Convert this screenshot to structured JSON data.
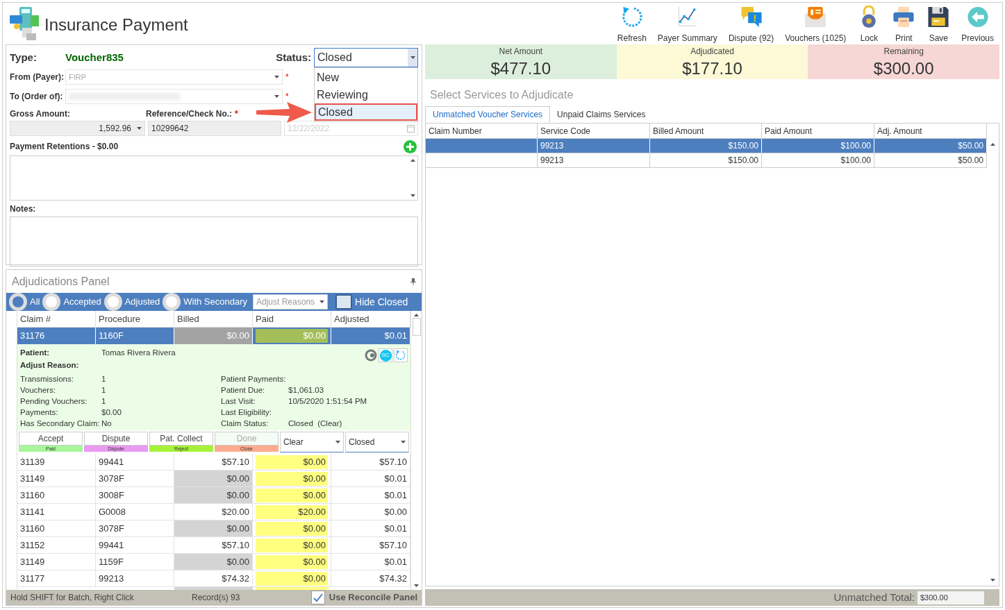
{
  "header": {
    "title": "Insurance Payment",
    "toolbar": [
      {
        "kind": "refresh",
        "label": "Refresh"
      },
      {
        "kind": "chart",
        "label": "Payer Summary"
      },
      {
        "kind": "dispute",
        "label": "Dispute (92)"
      },
      {
        "kind": "vouchers",
        "label": "Vouchers (1025)"
      },
      {
        "kind": "lock",
        "label": "Lock"
      },
      {
        "kind": "print",
        "label": "Print"
      },
      {
        "kind": "save",
        "label": "Save"
      },
      {
        "kind": "previous",
        "label": "Previous"
      }
    ]
  },
  "form": {
    "type_label": "Type:",
    "type_value": "Voucher835",
    "status_label": "Status:",
    "status_value": "Closed",
    "status_options": [
      {
        "label": "New",
        "selected": false
      },
      {
        "label": "Reviewing",
        "selected": false
      },
      {
        "label": "Closed",
        "selected": true
      }
    ],
    "from_label": "From (Payer):",
    "from_value": "FIRP",
    "to_label": "To (Order of):",
    "required_mark": "*",
    "gross_label": "Gross Amount:",
    "gross_value": "1,592.96",
    "reference_label": "Reference/Check No.:",
    "reference_value": "10299642",
    "date_value": "12/22/2022",
    "retentions_label": "Payment Retentions - $0.00",
    "notes_label": "Notes:"
  },
  "adjudications": {
    "title": "Adjudications Panel",
    "filters": [
      {
        "label": "All",
        "selected": true
      },
      {
        "label": "Accepted",
        "selected": false
      },
      {
        "label": "Adjusted",
        "selected": false
      },
      {
        "label": "With Secondary",
        "selected": false
      }
    ],
    "adjust_reasons": "Adjust Reasons",
    "hide_closed": {
      "label": "Hide Closed",
      "checked": false
    },
    "columns": [
      "Claim #",
      "Procedure",
      "Billed",
      "Paid",
      "Adjusted"
    ],
    "selected_row": [
      "31176",
      "1160F",
      "$0.00",
      "$0.00",
      "$0.01"
    ],
    "detail": {
      "patient_label": "Patient:",
      "patient_value": "Tomas Rivera Rivera",
      "adjust_reason_label": "Adjust Reason:",
      "badge": "SC",
      "left_fields": [
        {
          "label": "Transmissions:",
          "value": "1"
        },
        {
          "label": "Vouchers:",
          "value": "1"
        },
        {
          "label": "Pending Vouchers:",
          "value": "1"
        },
        {
          "label": "Payments:",
          "value": "$0.00"
        },
        {
          "label": "Has Secondary Claim:",
          "value": "No"
        }
      ],
      "right_fields": [
        {
          "label": "Patient Payments:"
        },
        {
          "label": "Patient Due:",
          "value": "$1,061.03"
        },
        {
          "label": "Last Visit:",
          "value": "10/5/2020 1:51:54 PM"
        },
        {
          "label": "Last Eligibility:"
        },
        {
          "label": "Claim Status:",
          "value": "Closed  (Clear)"
        }
      ],
      "actions": [
        {
          "label": "Accept",
          "tag": "Paid",
          "color": "#a8f59a",
          "disabled": false
        },
        {
          "label": "Dispute",
          "tag": "Dispute",
          "color": "#e89bf0",
          "disabled": false
        },
        {
          "label": "Pat. Collect",
          "tag": "Reject",
          "color": "#a6f23a",
          "disabled": false
        },
        {
          "label": "Done",
          "tag": "Close",
          "color": "#fcab8e",
          "disabled": true
        }
      ],
      "dropdowns": [
        "Clear",
        "Closed"
      ]
    },
    "rows": [
      {
        "cells": [
          "31139",
          "99441",
          "$57.10",
          "$0.00",
          "$57.10"
        ],
        "billed_shaded": false
      },
      {
        "cells": [
          "31149",
          "3078F",
          "$0.00",
          "$0.00",
          "$0.01"
        ],
        "billed_shaded": true
      },
      {
        "cells": [
          "31160",
          "3008F",
          "$0.00",
          "$0.00",
          "$0.01"
        ],
        "billed_shaded": true
      },
      {
        "cells": [
          "31141",
          "G0008",
          "$20.00",
          "$20.00",
          "$0.00"
        ],
        "billed_shaded": false
      },
      {
        "cells": [
          "31160",
          "3078F",
          "$0.00",
          "$0.00",
          "$0.01"
        ],
        "billed_shaded": true
      },
      {
        "cells": [
          "31152",
          "99441",
          "$57.10",
          "$0.00",
          "$57.10"
        ],
        "billed_shaded": false
      },
      {
        "cells": [
          "31149",
          "1159F",
          "$0.00",
          "$0.00",
          "$0.01"
        ],
        "billed_shaded": true
      },
      {
        "cells": [
          "31177",
          "99213",
          "$74.32",
          "$0.00",
          "$74.32"
        ],
        "billed_shaded": false
      }
    ],
    "status_text": "Hold SHIFT for Batch, Right Click",
    "records": "Record(s) 93",
    "use_reconcile": {
      "label": "Use Reconcile Panel",
      "checked": true
    }
  },
  "services": {
    "summary": [
      {
        "label": "Net Amount",
        "value": "$477.10",
        "color": "#dcefdc"
      },
      {
        "label": "Adjudicated",
        "value": "$177.10",
        "color": "#fdf9d7"
      },
      {
        "label": "Remaining",
        "value": "$300.00",
        "color": "#f7d6d6"
      }
    ],
    "title": "Select Services to Adjudicate",
    "tabs": [
      {
        "label": "Unmatched Voucher Services",
        "selected": true
      },
      {
        "label": "Unpaid Claims Services",
        "selected": false
      }
    ],
    "columns": [
      "Claim Number",
      "Service Code",
      "Billed Amount",
      "Paid Amount",
      "Adj. Amount"
    ],
    "rows": [
      {
        "cells": [
          "",
          "99213",
          "$150.00",
          "$100.00",
          "$50.00"
        ],
        "selected": true
      },
      {
        "cells": [
          "",
          "99213",
          "$150.00",
          "$100.00",
          "$50.00"
        ],
        "selected": false
      }
    ],
    "unmatched_label": "Unmatched Total:",
    "unmatched_value": "$300.00"
  }
}
